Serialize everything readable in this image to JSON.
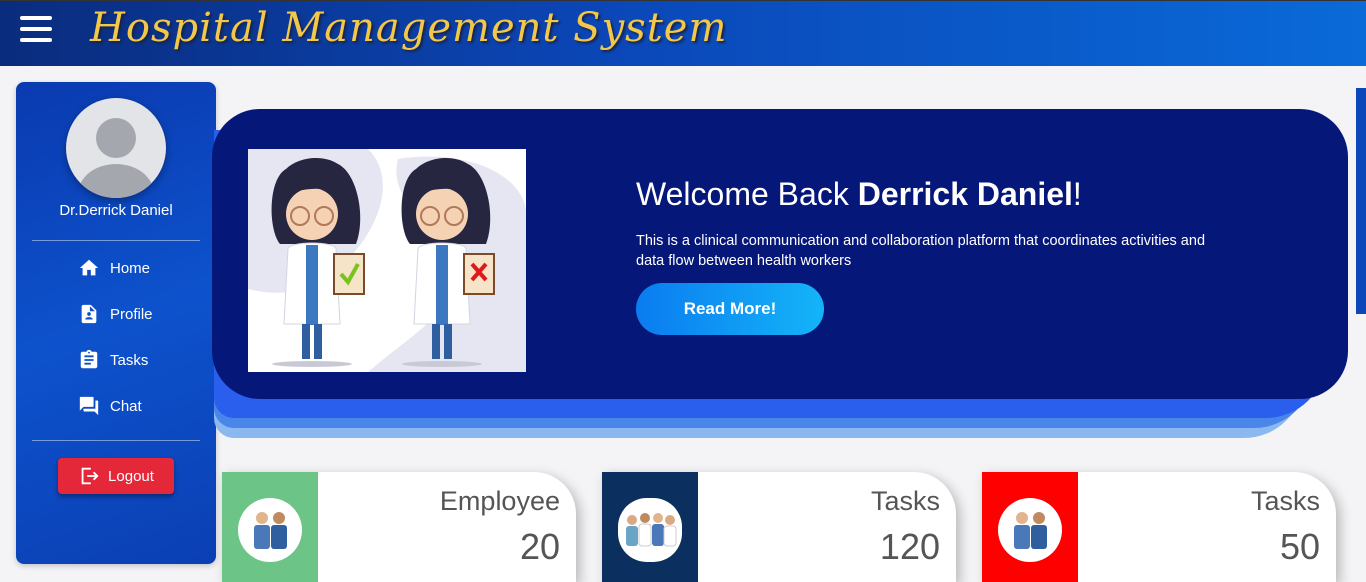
{
  "header": {
    "title": "Hospital Management System",
    "menu_icon": "hamburger-menu-icon"
  },
  "sidebar": {
    "doctor_name": "Dr.Derrick Daniel",
    "items": [
      {
        "label": "Home",
        "icon": "home-icon"
      },
      {
        "label": "Profile",
        "icon": "profile-icon"
      },
      {
        "label": "Tasks",
        "icon": "clipboard-icon"
      },
      {
        "label": "Chat",
        "icon": "chat-icon"
      }
    ],
    "logout_label": "Logout"
  },
  "welcome": {
    "greeting": "Welcome Back ",
    "name": "Derrick Daniel",
    "exclaim": "!",
    "description": "This is a clinical communication and collaboration platform that coordinates activities and data flow between health workers",
    "button_label": "Read More!"
  },
  "stats": [
    {
      "label": "Employee",
      "value": "20",
      "color": "#6cc487"
    },
    {
      "label": "Tasks",
      "value": "120",
      "color": "#0b2f5e"
    },
    {
      "label": "Tasks",
      "value": "50",
      "color": "#ff0000"
    }
  ],
  "colors": {
    "topbar": "#0b47b8",
    "title": "#f3c74a",
    "sidebar": "#0d52cc",
    "banner": "#06177a",
    "logout": "#e4283a",
    "read_more": "#0a7cf0"
  }
}
